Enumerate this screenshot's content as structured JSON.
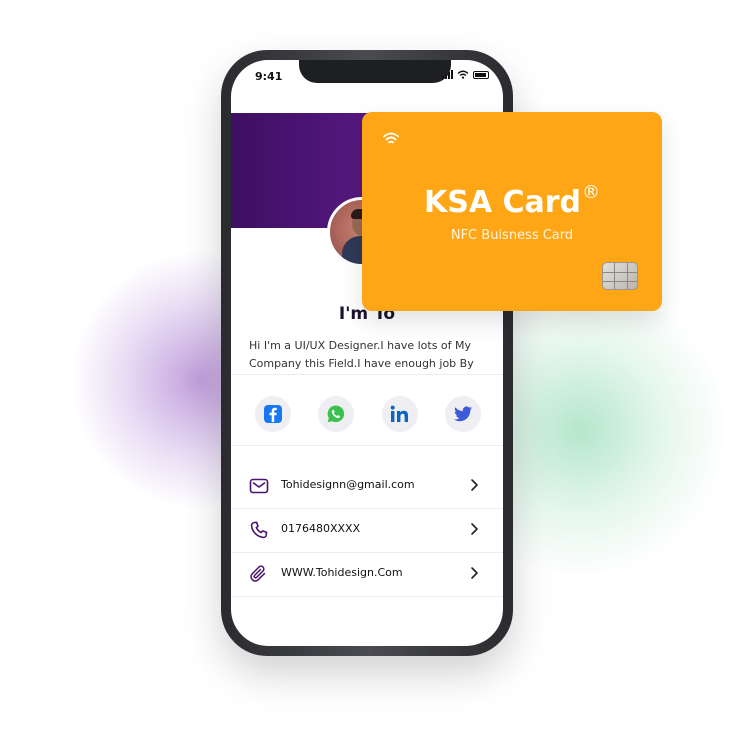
{
  "status_bar": {
    "time": "9:41"
  },
  "profile": {
    "name": "I'm To",
    "bio": "Hi I'm a UI/UX Designer.I have lots of My Company this Field.I have enough job  By"
  },
  "socials": [
    {
      "icon": "facebook-icon",
      "color": "#1877f2"
    },
    {
      "icon": "whatsapp-icon",
      "color": "#3cc04f"
    },
    {
      "icon": "linkedin-icon",
      "color": "#0a66c2"
    },
    {
      "icon": "twitter-icon",
      "color": "#3d5bd9"
    }
  ],
  "contacts": [
    {
      "icon": "mail-icon",
      "text": "Tohidesignn@gmail.com"
    },
    {
      "icon": "phone-icon",
      "text": "0176480XXXX"
    },
    {
      "icon": "link-icon",
      "text": "WWW.Tohidesign.Com"
    }
  ],
  "card": {
    "title": "KSA Card",
    "trademark": "®",
    "subtitle": "NFC Buisness Card",
    "color": "#fea616"
  },
  "theme": {
    "banner": "#4a1470",
    "accent": "#4a1470"
  }
}
